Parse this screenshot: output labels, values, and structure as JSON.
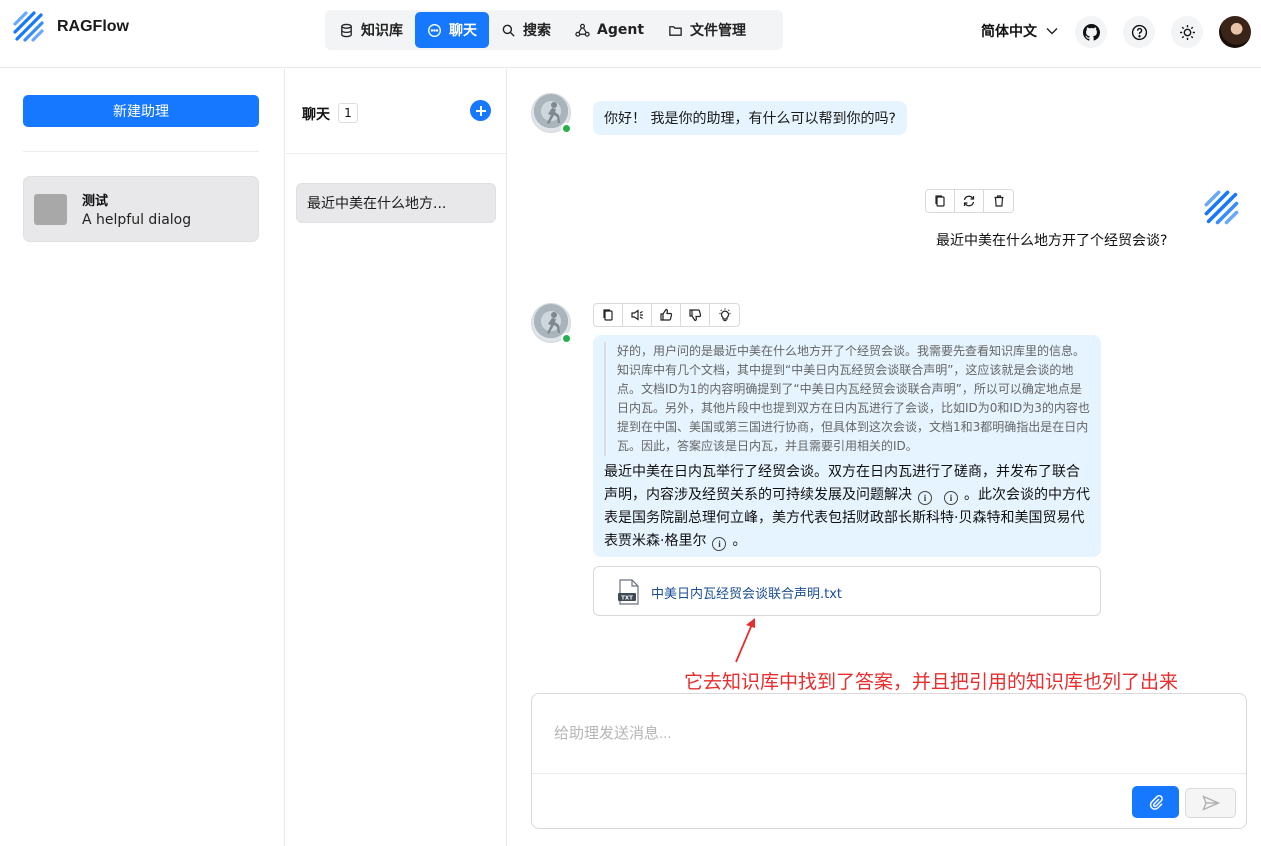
{
  "app": {
    "name": "RAGFlow"
  },
  "nav": {
    "items": [
      {
        "label": "知识库",
        "icon": "database-icon"
      },
      {
        "label": "聊天",
        "icon": "chat-icon",
        "active": true
      },
      {
        "label": "搜索",
        "icon": "search-icon"
      },
      {
        "label": "Agent",
        "icon": "agent-icon"
      },
      {
        "label": "文件管理",
        "icon": "folder-icon"
      }
    ]
  },
  "header": {
    "language": "简体中文"
  },
  "left_panel": {
    "new_assistant_label": "新建助理",
    "assistants": [
      {
        "name": "测试",
        "description": "A helpful dialog"
      }
    ]
  },
  "conversations": {
    "title": "聊天",
    "count": "1",
    "items": [
      {
        "title": "最近中美在什么地方..."
      }
    ]
  },
  "messages": {
    "greeting": "你好！ 我是你的助理，有什么可以帮到你的吗?",
    "user_question": "最近中美在什么地方开了个经贸会谈?",
    "thinking": "好的，用户问的是最近中美在什么地方开了个经贸会谈。我需要先查看知识库里的信息。知识库中有几个文档，其中提到“中美日内瓦经贸会谈联合声明”，这应该就是会谈的地点。文档ID为1的内容明确提到了“中美日内瓦经贸会谈联合声明”，所以可以确定地点是日内瓦。另外，其他片段中也提到双方在日内瓦进行了会谈，比如ID为0和ID为3的内容也提到在中国、美国或第三国进行协商，但具体到这次会谈，文档1和3都明确指出是在日内瓦。因此，答案应该是日内瓦，并且需要引用相关的ID。",
    "answer_part1": "最近中美在日内瓦举行了经贸会谈。双方在日内瓦进行了磋商，并发布了联合声明，内容涉及经贸关系的可持续发展及问题解决",
    "answer_part2": "。此次会谈的中方代表是国务院副总理何立峰，美方代表包括财政部长斯科特·贝森特和美国贸易代表贾米森·格里尔",
    "answer_part3": "。",
    "reference_doc": "中美日内瓦经贸会谈联合声明.txt",
    "doc_badge": "TXT"
  },
  "annotation": "它去知识库中找到了答案，并且把引用的知识库也列了出来",
  "input": {
    "placeholder": "给助理发送消息..."
  },
  "colors": {
    "accent": "#1677ff",
    "bubble": "#e6f4ff",
    "annotation": "#e62e2e",
    "online": "#22b14c"
  }
}
